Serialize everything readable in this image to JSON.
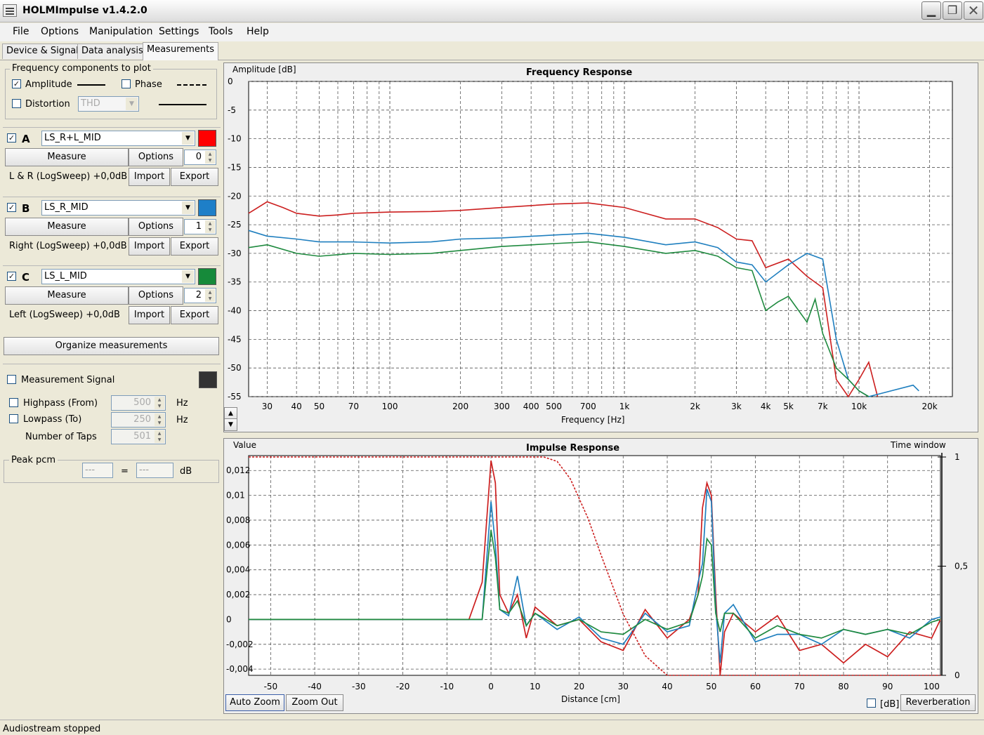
{
  "window": {
    "title": "HOLMImpulse  v1.4.2.0"
  },
  "menu": [
    "File",
    "Options",
    "Manipulation",
    "Settings",
    "Tools",
    "Help"
  ],
  "tabs": [
    "Device & Signal",
    "Data analysis",
    "Measurements"
  ],
  "freq_components": {
    "title": "Frequency components to plot",
    "amplitude_label": "Amplitude",
    "amplitude_checked": true,
    "phase_label": "Phase",
    "phase_checked": false,
    "distortion_label": "Distortion",
    "distortion_checked": false,
    "distortion_select": "THD"
  },
  "channels": [
    {
      "letter": "A",
      "checked": true,
      "name": "LS_R+L_MID",
      "color": "#ff0000",
      "measure": "Measure",
      "options": "Options",
      "index": "0",
      "info": "L & R (LogSweep) +0,0dB",
      "import": "Import",
      "export": "Export"
    },
    {
      "letter": "B",
      "checked": true,
      "name": "LS_R_MID",
      "color": "#1e7fc8",
      "measure": "Measure",
      "options": "Options",
      "index": "1",
      "info": "Right (LogSweep) +0,0dB",
      "import": "Import",
      "export": "Export"
    },
    {
      "letter": "C",
      "checked": true,
      "name": "LS_L_MID",
      "color": "#168a3a",
      "measure": "Measure",
      "options": "Options",
      "index": "2",
      "info": "Left (LogSweep) +0,0dB",
      "import": "Import",
      "export": "Export"
    }
  ],
  "organize_label": "Organize measurements",
  "signal": {
    "label": "Measurement Signal",
    "checked": false,
    "color": "#333333",
    "highpass_label": "Highpass (From)",
    "highpass_value": "500",
    "lowpass_label": "Lowpass (To)",
    "lowpass_value": "250",
    "hz": "Hz",
    "taps_label": "Number of Taps",
    "taps_value": "501"
  },
  "peak": {
    "title": "Peak pcm",
    "value1": "---",
    "eq": "=",
    "value2": "---",
    "unit": "dB"
  },
  "freq_plot": {
    "ylabel": "Amplitude [dB]",
    "title": "Frequency Response",
    "xlabel": "Frequency [Hz]",
    "yticks": [
      "0",
      "-5",
      "-10",
      "-15",
      "-20",
      "-25",
      "-30",
      "-35",
      "-40",
      "-45",
      "-50",
      "-55"
    ],
    "xticks": [
      "30",
      "40",
      "50",
      "70",
      "100",
      "200",
      "300",
      "400",
      "500",
      "700",
      "1k",
      "2k",
      "3k",
      "4k",
      "5k",
      "7k",
      "10k",
      "20k"
    ]
  },
  "imp_plot": {
    "ylabel": "Value",
    "title": "Impulse Response",
    "window_label": "Time window",
    "xlabel": "Distance [cm]",
    "yticks": [
      "0,012",
      "0,01",
      "0,008",
      "0,006",
      "0,004",
      "0,002",
      "0",
      "-0,002",
      "-0,004"
    ],
    "xticks": [
      "-50",
      "-40",
      "-30",
      "-20",
      "-10",
      "0",
      "10",
      "20",
      "30",
      "40",
      "50",
      "60",
      "70",
      "80",
      "90",
      "100"
    ],
    "rticks": [
      "1",
      "0,5",
      "0"
    ],
    "auto_zoom": "Auto Zoom",
    "zoom_out": "Zoom Out",
    "db_label": "[dB]",
    "reverberation": "Reverberation"
  },
  "chart_data": [
    {
      "type": "line",
      "title": "Frequency Response",
      "xlabel": "Frequency [Hz]",
      "ylabel": "Amplitude [dB]",
      "xscale": "log",
      "xlim": [
        25,
        25000
      ],
      "ylim": [
        -55,
        0
      ],
      "grid": true,
      "series": [
        {
          "color": "#cc1f1f",
          "x": [
            25,
            30,
            35,
            40,
            50,
            60,
            70,
            100,
            150,
            200,
            300,
            500,
            700,
            1000,
            1500,
            2000,
            2500,
            3000,
            3500,
            4000,
            5000,
            6000,
            7000,
            8000,
            9000,
            10000,
            11000,
            12000
          ],
          "y": [
            -23,
            -21,
            -22,
            -23,
            -23.5,
            -23.3,
            -23,
            -22.8,
            -22.7,
            -22.5,
            -22,
            -21.4,
            -21.2,
            -22,
            -24,
            -24,
            -25.5,
            -27.5,
            -27.8,
            -32.5,
            -31,
            -34,
            -36,
            -52,
            -56,
            -52,
            -49,
            -56
          ]
        },
        {
          "color": "#1f7fbf",
          "x": [
            25,
            30,
            40,
            50,
            70,
            100,
            150,
            200,
            300,
            500,
            700,
            1000,
            1500,
            2000,
            2500,
            3000,
            3500,
            4000,
            5000,
            6000,
            7000,
            8000,
            9000,
            10000,
            11000,
            17000,
            18000
          ],
          "y": [
            -26,
            -27,
            -27.5,
            -28,
            -28,
            -28.2,
            -28,
            -27.5,
            -27.3,
            -26.8,
            -26.5,
            -27.2,
            -28.5,
            -28,
            -29,
            -31.5,
            -32,
            -35,
            -32,
            -30,
            -31,
            -45,
            -52,
            -54,
            -55,
            -53,
            -54
          ]
        },
        {
          "color": "#1f8a3f",
          "x": [
            25,
            30,
            40,
            50,
            70,
            100,
            150,
            200,
            300,
            500,
            700,
            1000,
            1500,
            2000,
            2500,
            3000,
            3500,
            4000,
            4500,
            5000,
            6000,
            6500,
            7000,
            8000,
            9000,
            10000,
            11000
          ],
          "y": [
            -29,
            -28.5,
            -30,
            -30.5,
            -30,
            -30.2,
            -30,
            -29.5,
            -28.8,
            -28.3,
            -28,
            -28.8,
            -30,
            -29.5,
            -30.5,
            -32.5,
            -33,
            -40,
            -38.5,
            -37.5,
            -42,
            -38,
            -44,
            -50,
            -52,
            -54,
            -55
          ]
        }
      ]
    },
    {
      "type": "line",
      "title": "Impulse Response",
      "xlabel": "Distance [cm]",
      "ylabel": "Value",
      "xlim": [
        -55,
        102
      ],
      "ylim": [
        -0.0045,
        0.0132
      ],
      "y2lim": [
        0,
        1
      ],
      "grid": true,
      "series": [
        {
          "color": "#cc1f1f",
          "x": [
            -55,
            -5,
            -2,
            0,
            1,
            2,
            4,
            6,
            8,
            10,
            15,
            20,
            25,
            30,
            35,
            40,
            45,
            47,
            48,
            49,
            50,
            51,
            52,
            53,
            55,
            60,
            65,
            70,
            75,
            80,
            85,
            90,
            95,
            100,
            102
          ],
          "y": [
            0,
            0,
            0.003,
            0.0128,
            0.011,
            0.002,
            0.0005,
            0.002,
            -0.0015,
            0.001,
            -0.0005,
            0,
            -0.0018,
            -0.0025,
            0.0008,
            -0.0015,
            0,
            0.002,
            0.009,
            0.011,
            0.01,
            0.002,
            -0.0045,
            -0.001,
            0.0005,
            -0.001,
            0.0003,
            -0.0025,
            -0.002,
            -0.0035,
            -0.002,
            -0.003,
            -0.001,
            -0.0015,
            0
          ]
        },
        {
          "color": "#1f7fbf",
          "x": [
            -55,
            -2,
            0,
            1,
            2,
            4,
            6,
            8,
            10,
            15,
            20,
            25,
            30,
            35,
            40,
            45,
            47,
            48,
            49,
            50,
            51,
            52,
            53,
            55,
            60,
            65,
            70,
            75,
            80,
            85,
            90,
            95,
            100,
            102
          ],
          "y": [
            0,
            0,
            0.0095,
            0.006,
            0.0008,
            0.0003,
            0.0035,
            -0.0005,
            0.0005,
            -0.0008,
            0.0002,
            -0.0015,
            -0.002,
            0.0005,
            -0.001,
            -0.0005,
            0.003,
            0.0045,
            0.0105,
            0.0095,
            0.001,
            -0.0035,
            0.0005,
            0.0012,
            -0.0018,
            -0.0012,
            -0.0012,
            -0.002,
            -0.0008,
            -0.0012,
            -0.0008,
            -0.0015,
            0,
            0.0002
          ]
        },
        {
          "color": "#1f8a3f",
          "x": [
            -55,
            -2,
            0,
            1,
            2,
            4,
            6,
            8,
            10,
            15,
            20,
            25,
            30,
            35,
            40,
            45,
            47,
            48,
            49,
            50,
            51,
            52,
            53,
            55,
            60,
            65,
            70,
            75,
            80,
            85,
            90,
            95,
            100,
            102
          ],
          "y": [
            0,
            0,
            0.0072,
            0.005,
            0.0008,
            0.0005,
            0.0015,
            -0.0005,
            0.0005,
            -0.0005,
            0,
            -0.001,
            -0.0012,
            0,
            -0.0008,
            -0.0002,
            0.002,
            0.0035,
            0.0065,
            0.006,
            0.0005,
            -0.001,
            0.0005,
            0.0005,
            -0.0015,
            -0.0005,
            -0.0012,
            -0.0015,
            -0.0008,
            -0.0012,
            -0.0008,
            -0.0012,
            -0.0002,
            0
          ]
        },
        {
          "color": "#cc1f1f",
          "dashed": true,
          "axis": "right",
          "x": [
            -55,
            12,
            15,
            18,
            22,
            25,
            30,
            35,
            40,
            102
          ],
          "y": [
            1,
            1,
            0.98,
            0.9,
            0.72,
            0.55,
            0.28,
            0.09,
            0,
            0
          ]
        }
      ]
    }
  ],
  "status": "Audiostream stopped"
}
